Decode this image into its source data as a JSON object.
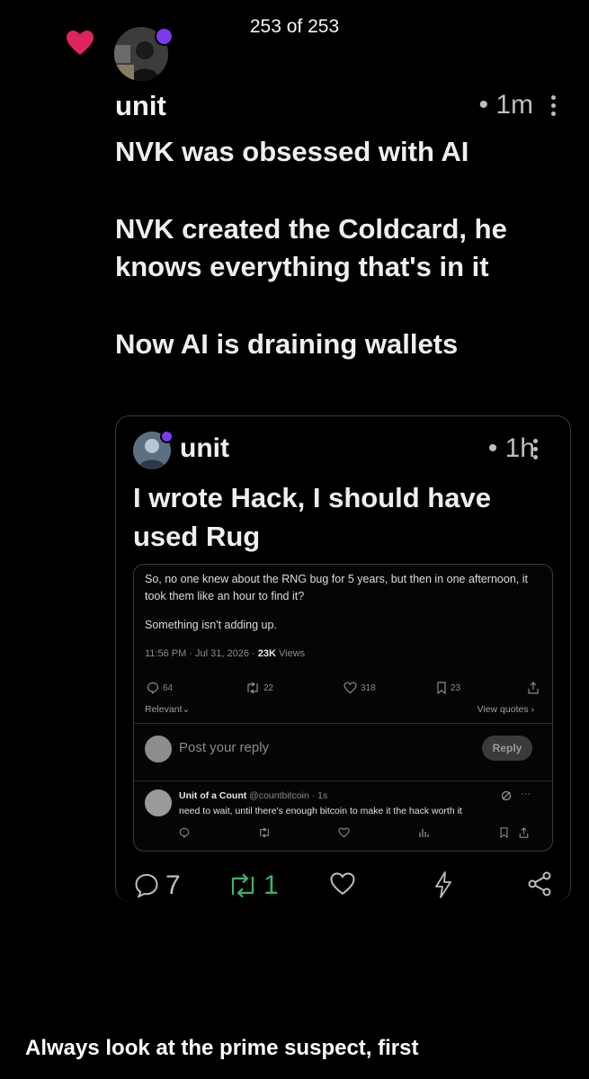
{
  "viewer": {
    "counter": "253 of 253"
  },
  "post": {
    "author": "unit",
    "time": "• 1m",
    "lines": [
      "NVK was obsessed with AI",
      "NVK created the Coldcard, he knows everything that's in it",
      "Now AI is draining wallets"
    ],
    "actions": {
      "replies": "7",
      "reposts": "1"
    },
    "accent_repost": "#3fb36b",
    "like_color": "#e0245e"
  },
  "quote": {
    "author": "unit",
    "time": "• 1h",
    "text": "I wrote Hack, I should have used Rug"
  },
  "screenshot": {
    "text1": "So, no one knew about the RNG bug for 5 years, but then in one afternoon, it took them like an hour to find it?",
    "text2": "Something isn't adding up.",
    "meta_prefix": "11:56 PM · Jul 31, 2026 · ",
    "views_count": "23K",
    "views_label": " Views",
    "stats": {
      "replies": "64",
      "reposts": "22",
      "likes": "318",
      "bookmarks": "23"
    },
    "relevant": "Relevant",
    "view_quotes": "View quotes ›",
    "reply_placeholder": "Post your reply",
    "reply_button": "Reply",
    "comment": {
      "name": "Unit of a Count",
      "handle": "@countbitcoin · 1s",
      "text": "need to wait, until there's enough bitcoin to make it the hack worth it"
    }
  },
  "caption": "Always look at the prime suspect, first"
}
